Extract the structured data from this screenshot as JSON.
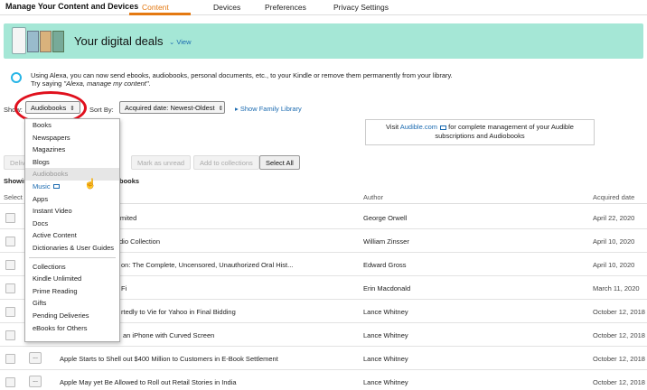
{
  "nav": {
    "app_title": "Manage Your Content and Devices",
    "tabs": [
      {
        "label": "Content",
        "active": true
      },
      {
        "label": "Devices",
        "active": false
      },
      {
        "label": "Preferences",
        "active": false
      },
      {
        "label": "Privacy Settings",
        "active": false
      }
    ],
    "accent_color": "#e47911"
  },
  "banner": {
    "title": "Your digital deals",
    "view_link": "⌄ View",
    "bg_color": "#a5e7d6"
  },
  "alexa": {
    "line1": "Using Alexa, you can now send ebooks, audiobooks, personal documents, etc., to your Kindle or remove them permanently from your library.",
    "line2_prefix": "Try saying ",
    "line2_quote": "\"Alexa, manage my content\"",
    "line2_suffix": "."
  },
  "controls": {
    "show_label": "Show:",
    "show_value": "Audiobooks",
    "sort_label": "Sort By:",
    "sort_value": "Acquired date: Newest-Oldest",
    "family_link": "▸ Show Family Library"
  },
  "audible": {
    "prefix": "Visit ",
    "link": "Audible.com",
    "suffix": " for complete management of your Audible",
    "line2": "subscriptions and Audiobooks"
  },
  "buttons": {
    "deliver": "Deliver",
    "mark_unread": "Mark as unread",
    "add_collections": "Add to collections",
    "select_all": "Select All"
  },
  "table": {
    "showing_prefix": "Showin",
    "showing_suffix": "books",
    "headers": {
      "select": "Select",
      "author": "Author",
      "acquired": "Acquired date"
    },
    "rows": [
      {
        "title": "Unlimited",
        "author": "George Orwell",
        "date": "April 22, 2020"
      },
      {
        "title": "dio Collection",
        "author": "William Zinsser",
        "date": "April 10, 2020"
      },
      {
        "title": "on: The Complete, Uncensored, Unauthorized Oral Hist...",
        "author": "Edward Gross",
        "date": "April 10, 2020"
      },
      {
        "title": "Fi",
        "author": "Erin Macdonald",
        "date": "March 11, 2020"
      },
      {
        "title": "rtedly to Vie for Yahoo in Final Bidding",
        "author": "Lance Whitney",
        "date": "October 12, 2018"
      },
      {
        "title": "an iPhone with Curved Screen",
        "author": "Lance Whitney",
        "date": "October 12, 2018"
      },
      {
        "title": "Apple Starts to Shell out $400 Million to Customers in E-Book Settlement",
        "author": "Lance Whitney",
        "date": "October 12, 2018",
        "more": "..."
      },
      {
        "title": "Apple May yet Be Allowed to Roll out Retail Stories in India",
        "author": "Lance Whitney",
        "date": "October 12, 2018",
        "more": "..."
      }
    ]
  },
  "dropdown": {
    "group1": [
      "Books",
      "Newspapers",
      "Magazines",
      "Blogs",
      "Audiobooks",
      "Music",
      "Apps",
      "Instant Video",
      "Docs",
      "Active Content",
      "Dictionaries & User Guides"
    ],
    "group2": [
      "Collections",
      "Kindle Unlimited",
      "Prime Reading",
      "Gifts",
      "Pending Deliveries",
      "eBooks for Others"
    ],
    "selected": "Audiobooks",
    "highlighted": "Music"
  }
}
